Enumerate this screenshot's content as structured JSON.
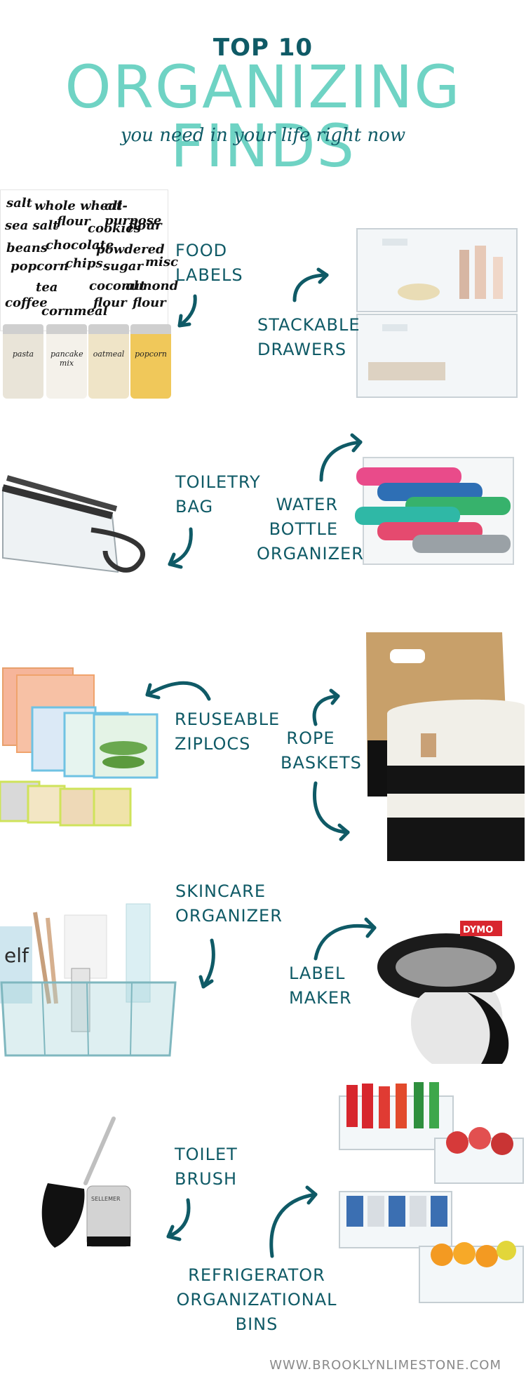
{
  "header": {
    "top": "TOP 10",
    "main": "ORGANIZING FINDS",
    "sub": "you need in your life right now"
  },
  "items": {
    "food_labels": [
      "FOOD",
      "LABELS"
    ],
    "stackable_drawers": [
      "STACKABLE",
      "DRAWERS"
    ],
    "toiletry_bag": [
      "TOILETRY",
      "BAG"
    ],
    "water_bottle": [
      "WATER",
      "BOTTLE",
      "ORGANIZER"
    ],
    "ziplocs": [
      "REUSEABLE",
      "ZIPLOCS"
    ],
    "rope_baskets": [
      "ROPE",
      "BASKETS"
    ],
    "skincare": [
      "SKINCARE",
      "ORGANIZER"
    ],
    "label_maker": [
      "LABEL",
      "MAKER"
    ],
    "toilet_brush": [
      "TOILET",
      "BRUSH"
    ],
    "fridge_bins": [
      "REFRIGERATOR",
      "ORGANIZATIONAL BINS"
    ]
  },
  "sticker_words": [
    "salt",
    "whole wheat",
    "all-purpose",
    "sea salt",
    "flour",
    "cookies",
    "flour",
    "beans",
    "chocolate",
    "powdered",
    "popcorn",
    "chips",
    "sugar",
    "misc",
    "tea",
    "coconut",
    "almond",
    "coffee",
    "cornmeal",
    "flour",
    "flour"
  ],
  "jar_labels": [
    "pasta",
    "pancake mix",
    "oatmeal",
    "popcorn"
  ],
  "brand_text": {
    "elf": "elf",
    "sellemer": "SELLEMER",
    "dymo": "DYMO"
  },
  "footer": "WWW.BROOKLYNLIMESTONE.COM",
  "colors": {
    "teal_dark": "#0f5a66",
    "mint": "#6fd3c4"
  }
}
